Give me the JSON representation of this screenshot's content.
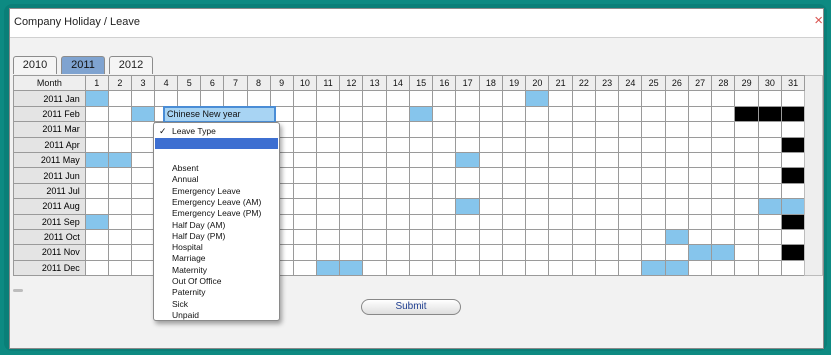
{
  "window": {
    "title": "Company Holiday / Leave",
    "close_icon": "×"
  },
  "tabs": [
    {
      "label": "2010",
      "active": false
    },
    {
      "label": "2011",
      "active": true
    },
    {
      "label": "2012",
      "active": false
    }
  ],
  "grid": {
    "month_header": "Month",
    "days": [
      "1",
      "2",
      "3",
      "4",
      "5",
      "6",
      "7",
      "8",
      "9",
      "10",
      "11",
      "12",
      "13",
      "14",
      "15",
      "16",
      "17",
      "18",
      "19",
      "20",
      "21",
      "22",
      "23",
      "24",
      "25",
      "26",
      "27",
      "28",
      "29",
      "30",
      "31"
    ],
    "red_days": [
      "6",
      "13",
      "20",
      "27"
    ],
    "months": [
      {
        "label": "2011 Jan",
        "blue": [
          1,
          20
        ],
        "black": []
      },
      {
        "label": "2011 Feb",
        "blue": [
          3,
          15
        ],
        "black": [
          29,
          30,
          31
        ]
      },
      {
        "label": "2011 Mar",
        "blue": [],
        "black": []
      },
      {
        "label": "2011 Apr",
        "blue": [],
        "black": [
          31
        ]
      },
      {
        "label": "2011 May",
        "blue": [
          1,
          2,
          17
        ],
        "black": []
      },
      {
        "label": "2011 Jun",
        "blue": [],
        "black": [
          31
        ]
      },
      {
        "label": "2011 Jul",
        "blue": [],
        "black": []
      },
      {
        "label": "2011 Aug",
        "blue": [
          17,
          30,
          31
        ],
        "black": []
      },
      {
        "label": "2011 Sep",
        "blue": [
          1
        ],
        "black": [
          31
        ]
      },
      {
        "label": "2011 Oct",
        "blue": [
          26
        ],
        "black": []
      },
      {
        "label": "2011 Nov",
        "blue": [
          27,
          28
        ],
        "black": [
          31
        ]
      },
      {
        "label": "2011 Dec",
        "blue": [
          11,
          12,
          25,
          26
        ],
        "black": []
      }
    ]
  },
  "leave_input": {
    "value": "Chinese New year"
  },
  "dropdown": {
    "selected_label": "Leave Type",
    "check_icon": "✓",
    "options": [
      "Absent",
      "Annual",
      "Emergency Leave",
      "Emergency Leave (AM)",
      "Emergency Leave (PM)",
      "Half Day (AM)",
      "Half Day (PM)",
      "Hospital",
      "Marriage",
      "Maternity",
      "Out Of Office",
      "Paternity",
      "Sick",
      "Unpaid"
    ]
  },
  "submit_label": "Submit",
  "colors": {
    "frame": "#0a7f78",
    "leave_blue": "#86c5ec",
    "blocked_black": "#000000",
    "active_tab": "#7fa3d0",
    "red_day": "#e23b3b"
  }
}
